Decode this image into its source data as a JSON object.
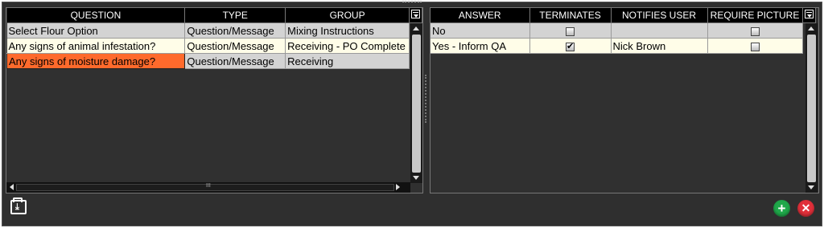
{
  "questions": {
    "columns": [
      "QUESTION",
      "TYPE",
      "GROUP"
    ],
    "rows": [
      {
        "question": "Select Flour Option",
        "type": "Question/Message",
        "group": "Mixing Instructions"
      },
      {
        "question": "Any signs of animal infestation?",
        "type": "Question/Message",
        "group": "Receiving - PO Complete"
      },
      {
        "question": "Any signs of moisture damage?",
        "type": "Question/Message",
        "group": "Receiving"
      }
    ],
    "header_icon": "column-chooser-icon"
  },
  "answers": {
    "columns": [
      "ANSWER",
      "TERMINATES",
      "NOTIFIES USER",
      "REQUIRE PICTURE"
    ],
    "rows": [
      {
        "answer": "No",
        "terminates": false,
        "notifies_user": "",
        "require_picture": false
      },
      {
        "answer": "Yes - Inform QA",
        "terminates": true,
        "notifies_user": "Nick Brown",
        "require_picture": false
      }
    ],
    "header_icon": "column-chooser-icon"
  },
  "toolbar": {
    "export_icon": "download-folder-icon",
    "add_label": "+",
    "close_label": "✕",
    "hscroll_grip": "III"
  },
  "colors": {
    "selected_cell": "#ff6a2c",
    "add_button": "#1fa84a",
    "close_button": "#e1303a"
  }
}
